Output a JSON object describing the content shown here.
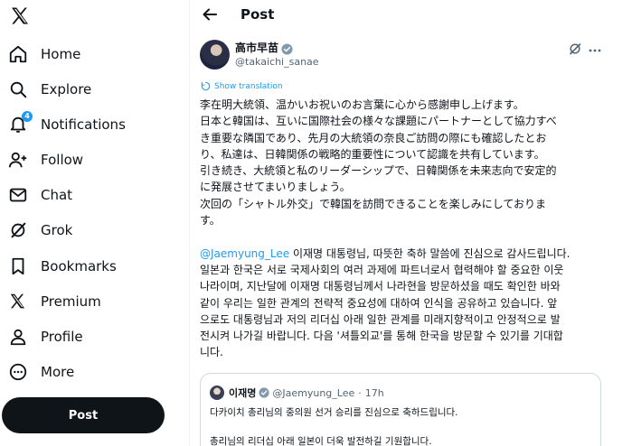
{
  "sidebar": {
    "logo_icon": "x-logo-icon",
    "items": [
      {
        "label": "Home",
        "icon": "home-icon"
      },
      {
        "label": "Explore",
        "icon": "search-icon"
      },
      {
        "label": "Notifications",
        "icon": "bell-icon",
        "badge": "4"
      },
      {
        "label": "Follow",
        "icon": "follow-icon"
      },
      {
        "label": "Chat",
        "icon": "mail-icon"
      },
      {
        "label": "Grok",
        "icon": "grok-icon"
      },
      {
        "label": "Bookmarks",
        "icon": "bookmark-icon"
      },
      {
        "label": "Premium",
        "icon": "x-premium-icon"
      },
      {
        "label": "Profile",
        "icon": "person-icon"
      },
      {
        "label": "More",
        "icon": "more-circle-icon"
      }
    ],
    "post_button": "Post"
  },
  "header": {
    "title": "Post"
  },
  "tweet": {
    "display_name": "高市早苗",
    "handle": "@takaichi_sanae",
    "show_translation": "Show translation",
    "jp_lines": [
      "李在明大統領、温かいお祝いのお言葉に心から感謝申し上げます。",
      "日本と韓国は、互いに国際社会の様々な課題にパートナーとして協力すべ",
      "き重要な隣国であり、先月の大統領の奈良ご訪問の際にも確認したとお",
      "り、私達は、日韓関係の戦略的重要性について認識を共有しています。",
      "引き続き、大統領と私のリーダーシップで、日韓関係を未来志向で安定的",
      "に発展させてまいりましょう。",
      "次回の「シャトル外交」で韓国を訪問できることを楽しみにしておりま",
      "す。"
    ],
    "kr_mention": "@Jaemyung_Lee",
    "kr_first_line_rest": " 이재명 대통령님, 따뜻한 축하 말씀에 진심으로 감사드립니다.",
    "kr_lines": [
      "일본과 한국은 서로 국제사회의 여러 과제에 파트너로서 협력해야 할 중요한 이웃",
      "나라이며, 지난달에 이재명 대통령님께서 나라현을 방문하셨을 때도 확인한 바와",
      "같이 우리는 일한 관계의 전략적 중요성에 대하여 인식을 공유하고 있습니다. 앞",
      "으로도 대통령님과 저의 리더십 아래 일한 관계를 미래지향적이고 안정적으로 발",
      "전시켜 나가길 바랍니다. 다음 '셔틀외교'를 통해 한국을 방문할 수 있기를 기대합",
      "니다."
    ]
  },
  "quoted": {
    "name": "이재명",
    "handle": "@Jaemyung_Lee",
    "separator": "·",
    "time": "17h",
    "line1": "다카이치 총리님의 중의원 선거 승리를 진심으로 축하드립니다.",
    "line2": "총리님의 리더십 아래 일본이 더욱 발전하길 기원합니다."
  },
  "colors": {
    "accent": "#1d9bf0",
    "text": "#0f1419",
    "secondary": "#536471",
    "border": "#cfd9de",
    "post_button_bg": "#0f1419"
  }
}
